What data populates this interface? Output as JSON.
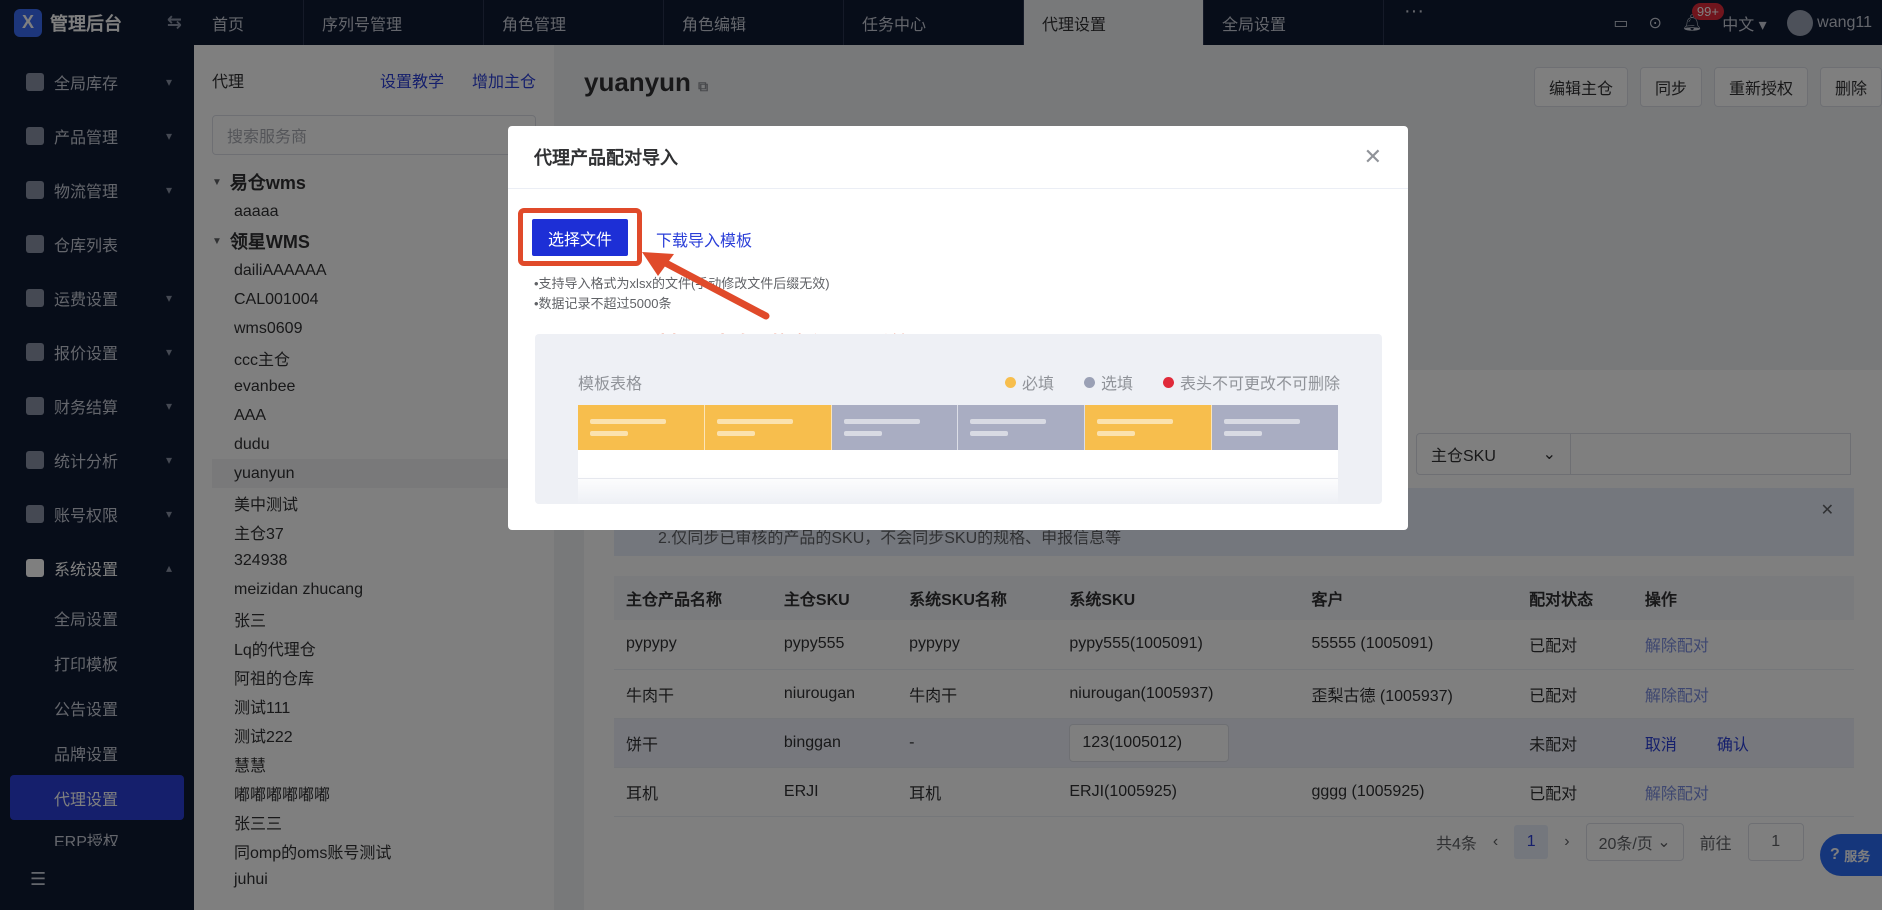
{
  "brand": {
    "title": "管理后台",
    "logo_letter": "X"
  },
  "tabs": [
    {
      "label": "首页"
    },
    {
      "label": "序列号管理"
    },
    {
      "label": "角色管理"
    },
    {
      "label": "角色编辑"
    },
    {
      "label": "任务中心"
    },
    {
      "label": "代理设置"
    },
    {
      "label": "全局设置"
    }
  ],
  "topbar": {
    "more": "···",
    "badge": "99+",
    "language": "中文",
    "user": "wang11"
  },
  "sidebar": {
    "items": [
      {
        "label": "全局库存"
      },
      {
        "label": "产品管理"
      },
      {
        "label": "物流管理"
      },
      {
        "label": "仓库列表"
      },
      {
        "label": "运费设置"
      },
      {
        "label": "报价设置"
      },
      {
        "label": "财务结算"
      },
      {
        "label": "统计分析"
      },
      {
        "label": "账号权限"
      },
      {
        "label": "系统设置"
      }
    ],
    "subitems": [
      {
        "label": "全局设置"
      },
      {
        "label": "打印模板"
      },
      {
        "label": "公告设置"
      },
      {
        "label": "品牌设置"
      },
      {
        "label": "代理设置"
      },
      {
        "label": "ERP授权"
      }
    ]
  },
  "agent_panel": {
    "title": "代理",
    "tutorial_link": "设置教学",
    "add_link": "增加主仓",
    "search_placeholder": "搜索服务商",
    "groups": [
      {
        "label": "易仓wms",
        "children": [
          "aaaaa"
        ]
      },
      {
        "label": "领星WMS",
        "children": [
          "dailiAAAAAA",
          "CAL001004",
          "wms0609",
          "ccc主仓",
          "evanbee",
          "AAA",
          "dudu",
          "yuanyun",
          "美中测试",
          "主仓37",
          "324938",
          "meizidan zhucang",
          "张三",
          "Lq的代理仓",
          "阿祖的仓库",
          "测试111",
          "测试222",
          "慧慧",
          "嘟嘟嘟嘟嘟嘟",
          "张三三",
          "同omp的oms账号测试",
          "juhui"
        ]
      }
    ]
  },
  "main": {
    "title": "yuanyun",
    "buttons": {
      "edit": "编辑主仓",
      "sync": "同步",
      "reauth": "重新授权",
      "delete": "删除"
    },
    "filter_select": "主仓SKU",
    "tip_text": "2.仅同步已审核的产品的SKU，不会同步SKU的规格、申报信息等",
    "table": {
      "headers": [
        "主仓产品名称",
        "主仓SKU",
        "系统SKU名称",
        "系统SKU",
        "客户",
        "配对状态",
        "操作"
      ],
      "rows": [
        {
          "c0": "pypypy",
          "c1": "pypy555",
          "c2": "pypypy",
          "c3": "pypy555(1005091)",
          "c4": "55555 (1005091)",
          "c5": "已配对",
          "a1": "解除配对"
        },
        {
          "c0": "牛肉干",
          "c1": "niurougan",
          "c2": "牛肉干",
          "c3": "niurougan(1005937)",
          "c4": "歪梨古德 (1005937)",
          "c5": "已配对",
          "a1": "解除配对"
        },
        {
          "c0": "饼干",
          "c1": "binggan",
          "c2": "-",
          "c3": "123(1005012)",
          "c4": "",
          "c5": "未配对",
          "a1": "取消",
          "a2": "确认"
        },
        {
          "c0": "耳机",
          "c1": "ERJI",
          "c2": "耳机",
          "c3": "ERJI(1005925)",
          "c4": "gggg (1005925)",
          "c5": "已配对",
          "a1": "解除配对"
        }
      ]
    },
    "pager": {
      "total": "共4条",
      "current_page": "1",
      "page_size": "20条/页",
      "goto_label": "前往",
      "goto_value": "1"
    },
    "service": "服务"
  },
  "dialog": {
    "title": "代理产品配对导入",
    "select_file": "选择文件",
    "download_template": "下载导入模板",
    "note1": "•支持导入格式为xlsx的文件(手动修改文件后缀无效)",
    "note2": "•数据记录不超过5000条",
    "annotation": "选择刚才填写的文件导入系统",
    "template_title": "模板表格",
    "legend": [
      {
        "label": "必填",
        "color": "#f7be4d"
      },
      {
        "label": "选填",
        "color": "#9aa0b5"
      },
      {
        "label": "表头不可更改不可删除",
        "color": "#e02a3a"
      }
    ],
    "template_columns": [
      {
        "color": "#f7be4d"
      },
      {
        "color": "#f7be4d"
      },
      {
        "color": "#a9adc2"
      },
      {
        "color": "#a9adc2"
      },
      {
        "color": "#f7be4d"
      },
      {
        "color": "#a9adc2"
      }
    ]
  }
}
